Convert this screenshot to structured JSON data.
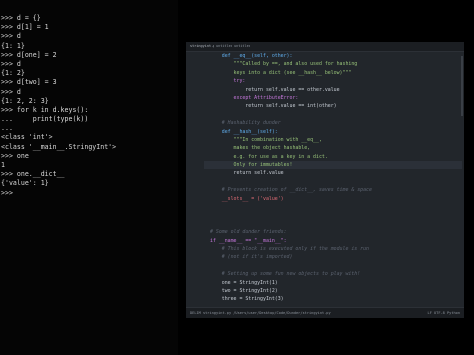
{
  "terminal": {
    "lines": [
      ">>> d = {}",
      ">>> d[1] = 1",
      ">>> d",
      "{1: 1}",
      ">>> d[one] = 2",
      ">>> d",
      "{1: 2}",
      ">>> d[two] = 3",
      ">>> d",
      "{1: 2, 2: 3}",
      ">>> for k in d.keys():",
      "...     print(type(k))",
      "...",
      "<class 'int'>",
      "<class '__main__.StringyInt'>",
      ">>> one",
      "1",
      ">>> one.__dict__",
      "{'value': 1}",
      ">>> "
    ]
  },
  "editor": {
    "tabs": [
      "stringyint.py",
      "untitled",
      "untitled"
    ],
    "current_line": 67,
    "code_lines": [
      {
        "n": "54",
        "text": "    def __eq__(self, other):",
        "cls": "c-fn"
      },
      {
        "n": "55",
        "text": "        \"\"\"Called by ==, and also used for hashing",
        "cls": "c-str"
      },
      {
        "n": "56",
        "text": "        keys into a dict (see __hash__ below)\"\"\"",
        "cls": "c-str"
      },
      {
        "n": "57",
        "text": "        try:",
        "cls": "c-kw"
      },
      {
        "n": "58",
        "text": "            return self.value == other.value",
        "cls": ""
      },
      {
        "n": "59",
        "text": "        except AttributeError:",
        "cls": "c-kw"
      },
      {
        "n": "60",
        "text": "            return self.value == int(other)",
        "cls": ""
      },
      {
        "n": "61",
        "text": "",
        "cls": ""
      },
      {
        "n": "62",
        "text": "    # Hashability dunder",
        "cls": "c-com"
      },
      {
        "n": "63",
        "text": "    def __hash__(self):",
        "cls": "c-fn"
      },
      {
        "n": "64",
        "text": "        \"\"\"In combination with __eq__,",
        "cls": "c-str"
      },
      {
        "n": "65",
        "text": "        makes the object hashable,",
        "cls": "c-str"
      },
      {
        "n": "66",
        "text": "        e.g. for use as a key in a dict.",
        "cls": "c-str"
      },
      {
        "n": "67",
        "text": "        Only for immutables!",
        "cls": "c-str"
      },
      {
        "n": "68",
        "text": "        return self.value",
        "cls": ""
      },
      {
        "n": "69",
        "text": "",
        "cls": ""
      },
      {
        "n": "70",
        "text": "    # Prevents creation of __dict__, saves time & space",
        "cls": "c-com"
      },
      {
        "n": "71",
        "text": "    __slots__ = ('value')",
        "cls": "c-dec"
      },
      {
        "n": "72",
        "text": "",
        "cls": ""
      },
      {
        "n": "73",
        "text": "",
        "cls": ""
      },
      {
        "n": "74",
        "text": "",
        "cls": ""
      },
      {
        "n": "75",
        "text": "# Some old dunder friends:",
        "cls": "c-com"
      },
      {
        "n": "76",
        "text": "if __name__ == \"__main__\":",
        "cls": "c-kw"
      },
      {
        "n": "77",
        "text": "    # This block is executed only if the module is run",
        "cls": "c-com"
      },
      {
        "n": "78",
        "text": "    # (not if it's imported)",
        "cls": "c-com"
      },
      {
        "n": "79",
        "text": "",
        "cls": ""
      },
      {
        "n": "80",
        "text": "    # Setting up some fun new objects to play with!",
        "cls": "c-com"
      },
      {
        "n": "81",
        "text": "    one = StringyInt(1)",
        "cls": ""
      },
      {
        "n": "82",
        "text": "    two = StringyInt(2)",
        "cls": ""
      },
      {
        "n": "83",
        "text": "    three = StringyInt(3)",
        "cls": ""
      },
      {
        "n": "84",
        "text": "",
        "cls": ""
      },
      {
        "n": "85",
        "text": "    # Run this module in interactive mode and play around!",
        "cls": "c-com"
      }
    ],
    "status": {
      "left": "DELIM  stringyint.py  /Users/user/Desktop/Code/Dunder/stringyint.py",
      "right": "LF  UTF-8  Python"
    }
  }
}
